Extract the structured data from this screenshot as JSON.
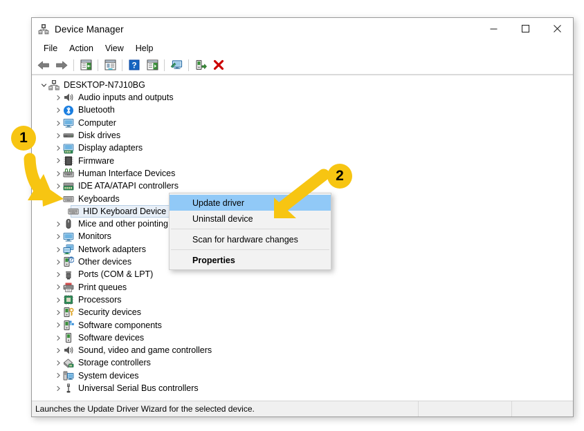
{
  "window": {
    "title": "Device Manager",
    "title_icon": "device-manager-icon",
    "controls": {
      "minimize": "minimize-icon",
      "maximize": "maximize-icon",
      "close": "close-icon"
    }
  },
  "menubar": {
    "items": [
      {
        "label": "File"
      },
      {
        "label": "Action"
      },
      {
        "label": "View"
      },
      {
        "label": "Help"
      }
    ]
  },
  "toolbar": {
    "buttons": [
      {
        "name": "back-arrow-icon",
        "icon": "back-arrow"
      },
      {
        "name": "forward-arrow-icon",
        "icon": "forward-arrow"
      },
      {
        "name": "separator",
        "icon": "separator"
      },
      {
        "name": "show-hide-console-tree-icon",
        "icon": "console-tree"
      },
      {
        "name": "separator",
        "icon": "separator"
      },
      {
        "name": "properties-icon",
        "icon": "properties"
      },
      {
        "name": "separator",
        "icon": "separator"
      },
      {
        "name": "help-icon",
        "icon": "help"
      },
      {
        "name": "show-action-pane-icon",
        "icon": "action-pane"
      },
      {
        "name": "separator",
        "icon": "separator"
      },
      {
        "name": "scan-for-hardware-changes-icon",
        "icon": "scan-hardware"
      },
      {
        "name": "separator",
        "icon": "separator"
      },
      {
        "name": "update-driver-icon",
        "icon": "update-driver"
      },
      {
        "name": "uninstall-device-icon",
        "icon": "uninstall-red-x"
      }
    ]
  },
  "tree": {
    "nodes": [
      {
        "label": "DESKTOP-N7J10BG",
        "depth": 0,
        "state": "expanded",
        "icon": "computer-tree-icon"
      },
      {
        "label": "Audio inputs and outputs",
        "depth": 1,
        "state": "collapsed",
        "icon": "speaker-icon"
      },
      {
        "label": "Bluetooth",
        "depth": 1,
        "state": "collapsed",
        "icon": "bluetooth-icon"
      },
      {
        "label": "Computer",
        "depth": 1,
        "state": "collapsed",
        "icon": "monitor-icon"
      },
      {
        "label": "Disk drives",
        "depth": 1,
        "state": "collapsed",
        "icon": "disk-drive-icon"
      },
      {
        "label": "Display adapters",
        "depth": 1,
        "state": "collapsed",
        "icon": "display-adapter-icon"
      },
      {
        "label": "Firmware",
        "depth": 1,
        "state": "collapsed",
        "icon": "firmware-chip-icon"
      },
      {
        "label": "Human Interface Devices",
        "depth": 1,
        "state": "collapsed",
        "icon": "hid-icon"
      },
      {
        "label": "IDE ATA/ATAPI controllers",
        "depth": 1,
        "state": "collapsed",
        "icon": "ide-controller-icon"
      },
      {
        "label": "Keyboards",
        "depth": 1,
        "state": "expanded",
        "icon": "keyboard-icon"
      },
      {
        "label": "HID Keyboard Device",
        "depth": 2,
        "state": "leaf",
        "icon": "keyboard-icon",
        "selected": true
      },
      {
        "label": "Mice and other pointing",
        "depth": 1,
        "state": "collapsed",
        "icon": "mouse-icon"
      },
      {
        "label": "Monitors",
        "depth": 1,
        "state": "collapsed",
        "icon": "monitor-icon"
      },
      {
        "label": "Network adapters",
        "depth": 1,
        "state": "collapsed",
        "icon": "network-adapter-icon"
      },
      {
        "label": "Other devices",
        "depth": 1,
        "state": "collapsed",
        "icon": "other-device-icon"
      },
      {
        "label": "Ports (COM & LPT)",
        "depth": 1,
        "state": "collapsed",
        "icon": "port-icon"
      },
      {
        "label": "Print queues",
        "depth": 1,
        "state": "collapsed",
        "icon": "printer-icon"
      },
      {
        "label": "Processors",
        "depth": 1,
        "state": "collapsed",
        "icon": "processor-icon"
      },
      {
        "label": "Security devices",
        "depth": 1,
        "state": "collapsed",
        "icon": "security-device-icon"
      },
      {
        "label": "Software components",
        "depth": 1,
        "state": "collapsed",
        "icon": "software-component-icon"
      },
      {
        "label": "Software devices",
        "depth": 1,
        "state": "collapsed",
        "icon": "software-device-icon"
      },
      {
        "label": "Sound, video and game controllers",
        "depth": 1,
        "state": "collapsed",
        "icon": "speaker-icon"
      },
      {
        "label": "Storage controllers",
        "depth": 1,
        "state": "collapsed",
        "icon": "storage-controller-icon"
      },
      {
        "label": "System devices",
        "depth": 1,
        "state": "collapsed",
        "icon": "system-device-icon"
      },
      {
        "label": "Universal Serial Bus controllers",
        "depth": 1,
        "state": "collapsed",
        "icon": "usb-icon"
      }
    ]
  },
  "context_menu": {
    "items": [
      {
        "label": "Update driver",
        "highlighted": true,
        "bold": false
      },
      {
        "label": "Uninstall device",
        "highlighted": false,
        "bold": false
      },
      {
        "separator": true
      },
      {
        "label": "Scan for hardware changes",
        "highlighted": false,
        "bold": false
      },
      {
        "separator": true
      },
      {
        "label": "Properties",
        "highlighted": false,
        "bold": true
      }
    ]
  },
  "statusbar": {
    "text": "Launches the Update Driver Wizard for the selected device.",
    "cell_b": "",
    "cell_c": ""
  },
  "annotations": {
    "badges": [
      {
        "number": "1"
      },
      {
        "number": "2"
      }
    ],
    "accent_color": "#f7c512"
  }
}
